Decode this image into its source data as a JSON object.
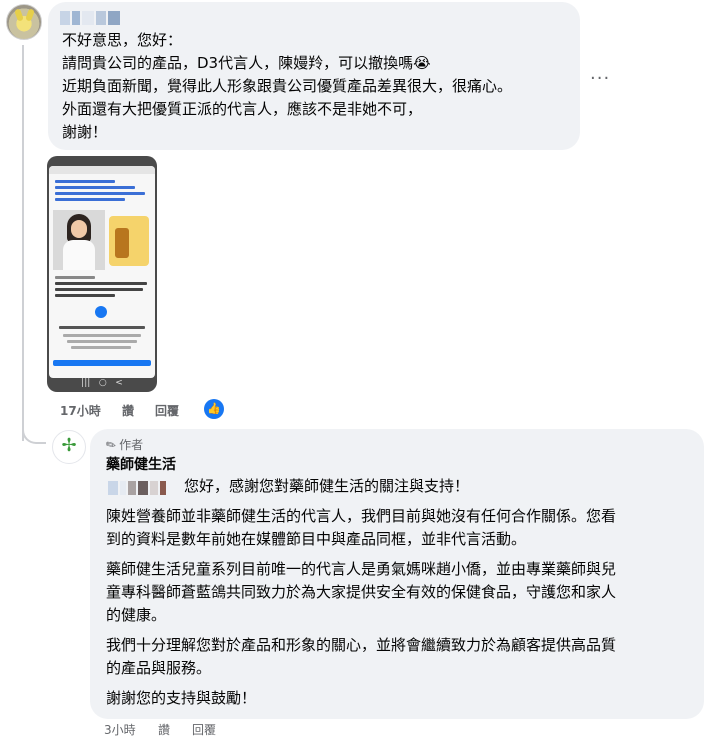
{
  "comment": {
    "lines": [
      "不好意思，您好：",
      "請問貴公司的產品，D3代言人，陳嫚羚，可以撤換嗎😭",
      "近期負面新聞，覺得此人形象跟貴公司優質產品差異很大，很痛心。",
      "外面還有大把優質正派的代言人，應該不是非她不可，",
      "謝謝！"
    ],
    "more_label": "···",
    "time": "17小時",
    "like_label": "讚",
    "reply_label": "回覆",
    "like_icon": "👍"
  },
  "reply": {
    "author_badge": "作者",
    "pen_icon": "✎",
    "page_name": "藥師健生活",
    "avatar_glyph": "✢",
    "greeting": "您好，感謝您對藥師健生活的關注與支持！",
    "para1": [
      "陳姓營養師並非藥師健生活的代言人，我們目前與她沒有任何合作關係。您看",
      "到的資料是數年前她在媒體節目中與產品同框，並非代言活動。"
    ],
    "para2": [
      "藥師健生活兒童系列目前唯一的代言人是勇氣媽咪趙小僑，並由專業藥師與兒",
      "童專科醫師蒼藍鴿共同致力於為大家提供安全有效的保健食品，守護您和家人",
      "的健康。"
    ],
    "para3": [
      "我們十分理解您對於產品和形象的關心，並將會繼續致力於為顧客提供高品質",
      "的產品與服務。"
    ],
    "closing": "謝謝您的支持與鼓勵！",
    "time": "3小時",
    "like_label": "讚",
    "reply_label": "回覆"
  }
}
